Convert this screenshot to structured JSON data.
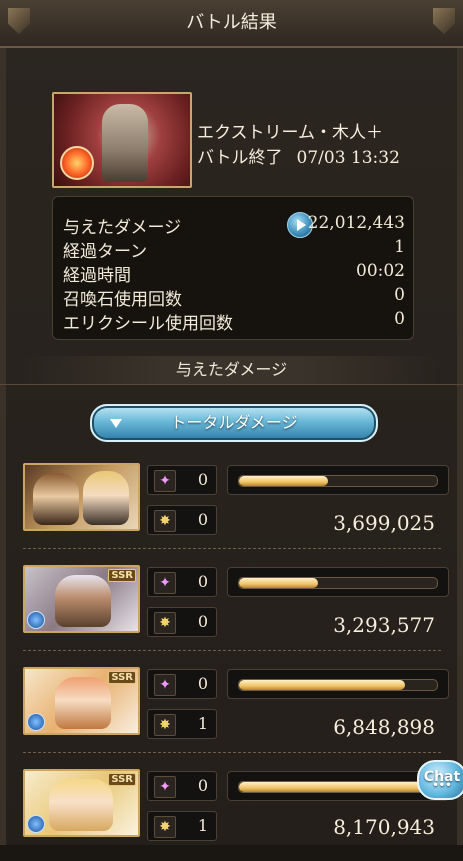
{
  "header": {
    "title": "バトル結果"
  },
  "quest": {
    "name": "エクストリーム・木人＋",
    "status": "バトル終了",
    "datetime": "07/03 13:32",
    "element_icon": "fire-element-icon"
  },
  "stats": {
    "rows": [
      {
        "label": "与えたダメージ",
        "value": "22,012,443"
      },
      {
        "label": "経過ターン",
        "value": "1"
      },
      {
        "label": "経過時間",
        "value": "00:02"
      },
      {
        "label": "召喚石使用回数",
        "value": "0"
      },
      {
        "label": "エリクシール使用回数",
        "value": "0"
      }
    ]
  },
  "damage_section": {
    "title": "与えたダメージ",
    "total_button": "トータルダメージ"
  },
  "characters": [
    {
      "rarity": "",
      "charge_attacks": "0",
      "ougi": "0",
      "damage": "3,699,025",
      "bar_fraction": 0.45
    },
    {
      "rarity": "SSR",
      "charge_attacks": "0",
      "ougi": "0",
      "damage": "3,293,577",
      "bar_fraction": 0.4
    },
    {
      "rarity": "SSR",
      "charge_attacks": "0",
      "ougi": "1",
      "damage": "6,848,898",
      "bar_fraction": 0.84
    },
    {
      "rarity": "SSR",
      "charge_attacks": "0",
      "ougi": "1",
      "damage": "8,170,943",
      "bar_fraction": 1.0
    }
  ],
  "chat": {
    "label": "Chat",
    "dots": "•••"
  },
  "colors": {
    "accent_blue": "#3a8ab8",
    "bar_gold": "#f0c36a",
    "frame_gold": "#caa65e"
  }
}
